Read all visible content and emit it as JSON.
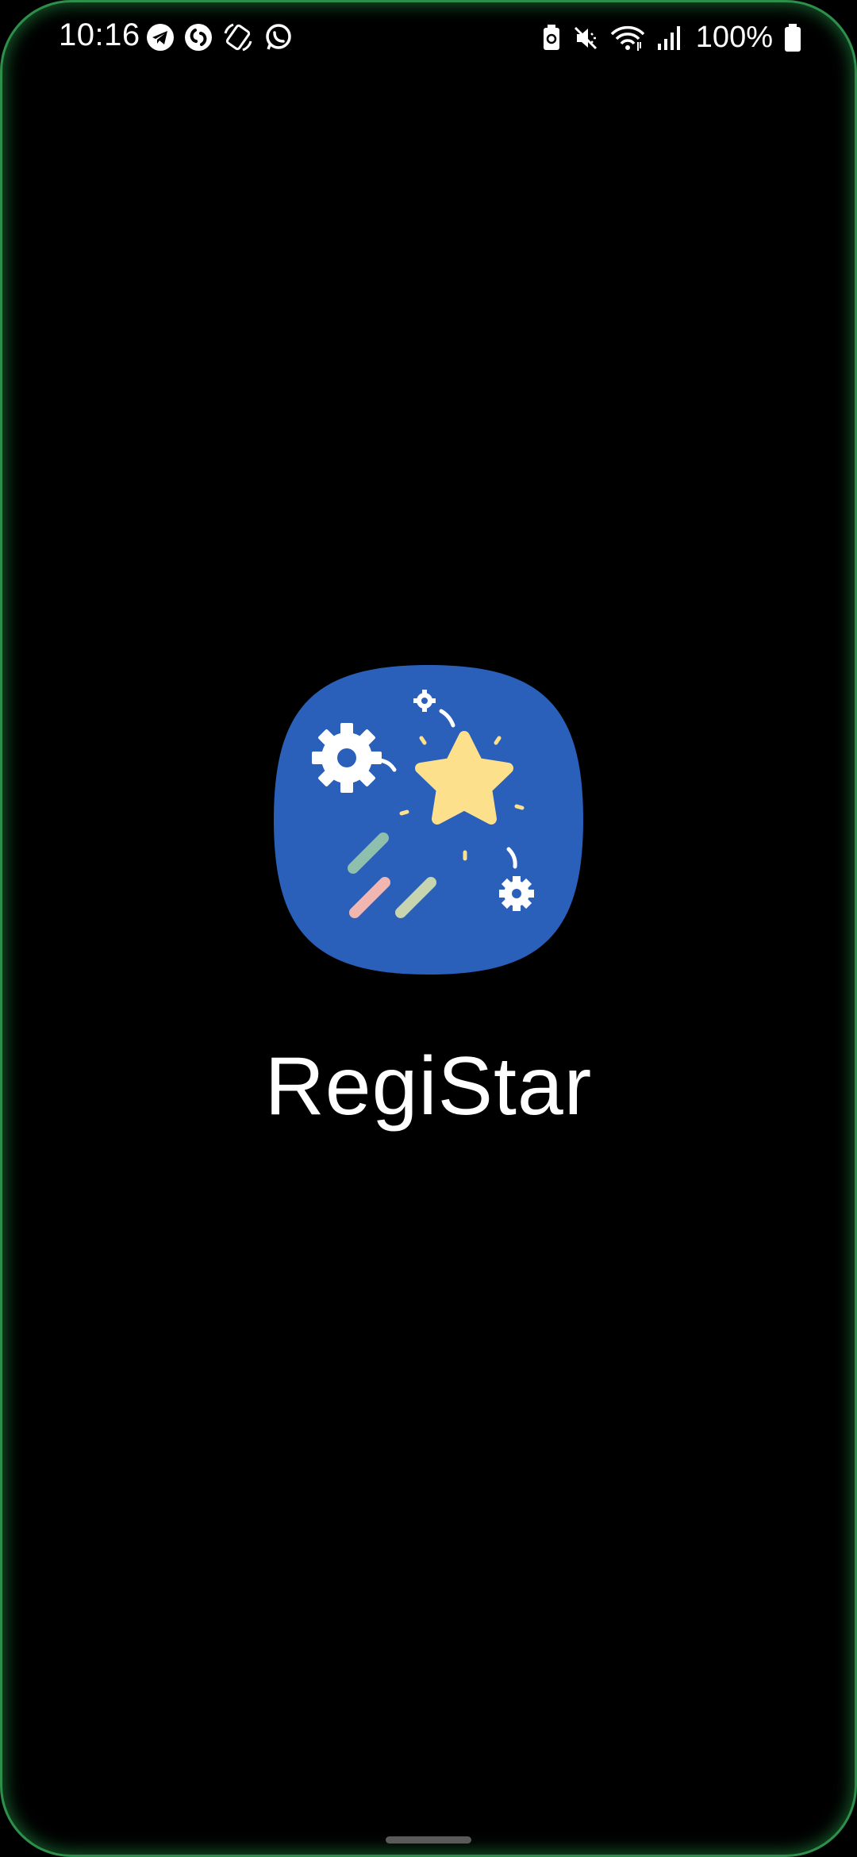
{
  "status_bar": {
    "time": "10:16",
    "battery_percent": "100%",
    "notification_icons": [
      "telegram-icon",
      "shazam-icon",
      "phone-rotate-icon",
      "whatsapp-icon"
    ],
    "system_icons": [
      "battery-saver-icon",
      "mute-icon",
      "wifi-icon",
      "signal-icon",
      "battery-icon"
    ]
  },
  "splash": {
    "app_name": "RegiStar"
  },
  "colors": {
    "background": "#000000",
    "edge_glow": "#2e8f4a",
    "icon_background": "#2a5fba",
    "star": "#fde08c"
  }
}
